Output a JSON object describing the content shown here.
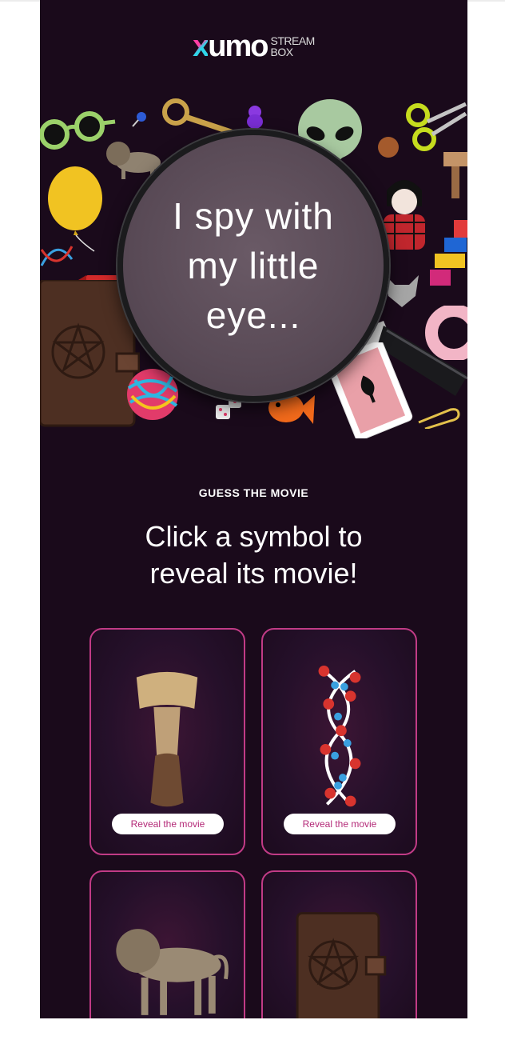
{
  "logo": {
    "brand": "xumo",
    "sub_line1": "STREAM",
    "sub_line2": "BOX"
  },
  "hero": {
    "line1": "I spy with",
    "line2": "my little",
    "line3": "eye..."
  },
  "section": {
    "eyebrow": "GUESS THE MOVIE",
    "headline_line1": "Click a symbol to",
    "headline_line2": "reveal its movie!"
  },
  "cards": [
    {
      "symbol": "wooden-totem",
      "button_label": "Reveal the movie"
    },
    {
      "symbol": "dna-helix",
      "button_label": "Reveal the movie"
    },
    {
      "symbol": "lion-figurine"
    },
    {
      "symbol": "pentagram-book"
    }
  ],
  "colors": {
    "background": "#1a0a1b",
    "accent": "#c13b86",
    "button_text": "#b42a78"
  }
}
